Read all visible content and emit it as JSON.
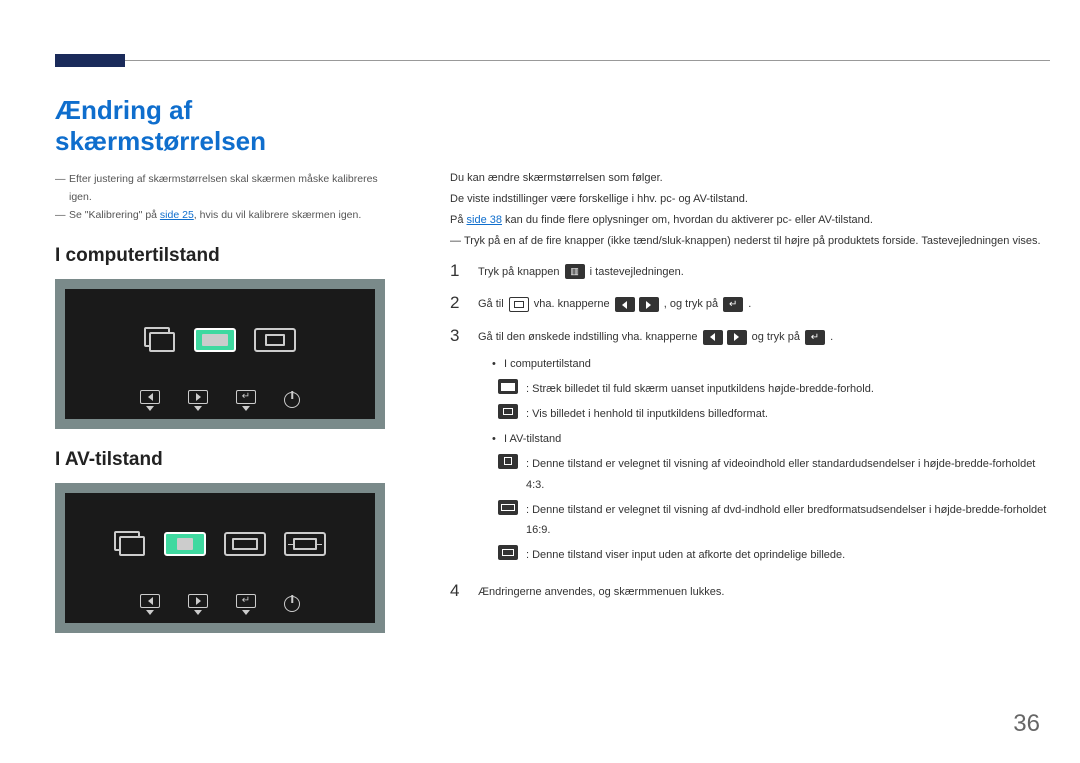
{
  "page_title": "Ændring af skærmstørrelsen",
  "notes": [
    "Efter justering af skærmstørrelsen skal skærmen måske kalibreres igen.",
    "Se \"Kalibrering\" på "
  ],
  "note2_link": "side 25",
  "note2_tail": ", hvis du vil kalibrere skærmen igen.",
  "sub_head_pc": "I computertilstand",
  "sub_head_av": "I AV-tilstand",
  "right_intro": [
    "Du kan ændre skærmstørrelsen som følger.",
    "De viste indstillinger være forskellige i hhv. pc- og AV-tilstand.",
    "På "
  ],
  "right_intro_link": "side 38",
  "right_intro_tail": " kan du finde flere oplysninger om, hvordan du aktiverer pc- eller AV-tilstand.",
  "right_note": "Tryk på en af de fire knapper (ikke tænd/sluk-knappen) nederst til højre på produktets forside. Tastevejledningen vises.",
  "steps": {
    "s1_a": "Tryk på knappen ",
    "s1_b": " i tastevejledningen.",
    "s2_a": "Gå til ",
    "s2_b": " vha. knapperne ",
    "s2_c": ", og tryk på ",
    "s2_d": ".",
    "s3_a": "Gå til den ønskede indstilling vha. knapperne ",
    "s3_b": " og tryk på ",
    "s3_c": ".",
    "s4": "Ændringerne anvendes, og skærmmenuen lukkes."
  },
  "mode_labels": {
    "pc_head": "I computertilstand",
    "pc_full": ": Stræk billedet til fuld skærm uanset inputkildens højde-bredde-forhold.",
    "pc_auto": ": Vis billedet i henhold til inputkildens billedformat.",
    "av_head": "I AV-tilstand",
    "av_43": ": Denne tilstand er velegnet til visning af videoindhold eller standardudsendelser i højde-bredde-forholdet 4:3.",
    "av_169_a": ": Denne tilstand er velegnet til visning af dvd-indhold eller bredformatsudsendelser i højde-bredde-forholdet 16:9.",
    "av_orig": ": Denne tilstand viser input uden at afkorte det oprindelige billede."
  },
  "page_number": "36"
}
